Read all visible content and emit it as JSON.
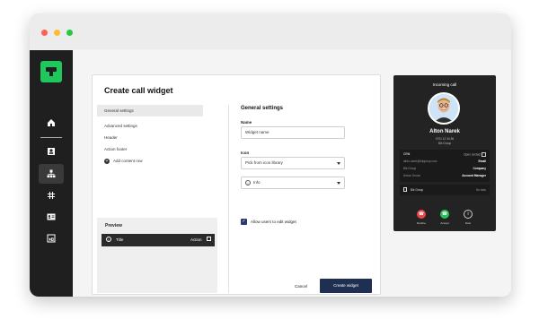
{
  "colors": {
    "accent": "#1fc85a",
    "primary_button": "#1f2f52",
    "decline": "#e5484d",
    "accept": "#2fbf5a",
    "window_dots": [
      "#ff5f57",
      "#febc2e",
      "#28c840"
    ]
  },
  "sidebar": {
    "icons": [
      "home-icon",
      "user-card-icon",
      "org-chart-icon",
      "hash-icon",
      "contact-card-icon",
      "widget-icon"
    ],
    "active_index": 2
  },
  "page": {
    "title": "Create call widget"
  },
  "left_menu": {
    "items": [
      "General settings",
      "Advanced settings",
      "Header",
      "Action footer"
    ],
    "add_label": "Add content row"
  },
  "preview": {
    "heading": "Preview",
    "row_title": "Title",
    "row_action": "Action"
  },
  "form": {
    "heading": "General settings",
    "name_label": "Name",
    "name_value": "Widget name",
    "icon_label": "Icon",
    "icon_select": "Pick from icon library",
    "second_select": "Info",
    "checkbox_label": "Allow users to edit widget",
    "checkbox_checked": true
  },
  "actions": {
    "cancel": "Cancel",
    "create": "Create widget"
  },
  "phone": {
    "header": "Incoming call",
    "caller_name": "Alton Narek",
    "caller_number": "0701 12 34 56",
    "caller_company": "BIk Group",
    "rows": [
      {
        "k": "CRM",
        "v": "Open contact"
      },
      {
        "k": "alton.narek@bkgroup.com",
        "v": "Email"
      },
      {
        "k": "Bik Group",
        "v": "Company"
      },
      {
        "k": "Aircon Gruda",
        "v": "Account Manager"
      }
    ],
    "group_label": "Bik Group",
    "group_right": "No tabs",
    "buttons": [
      "Decline",
      "Accept",
      "Note"
    ]
  }
}
